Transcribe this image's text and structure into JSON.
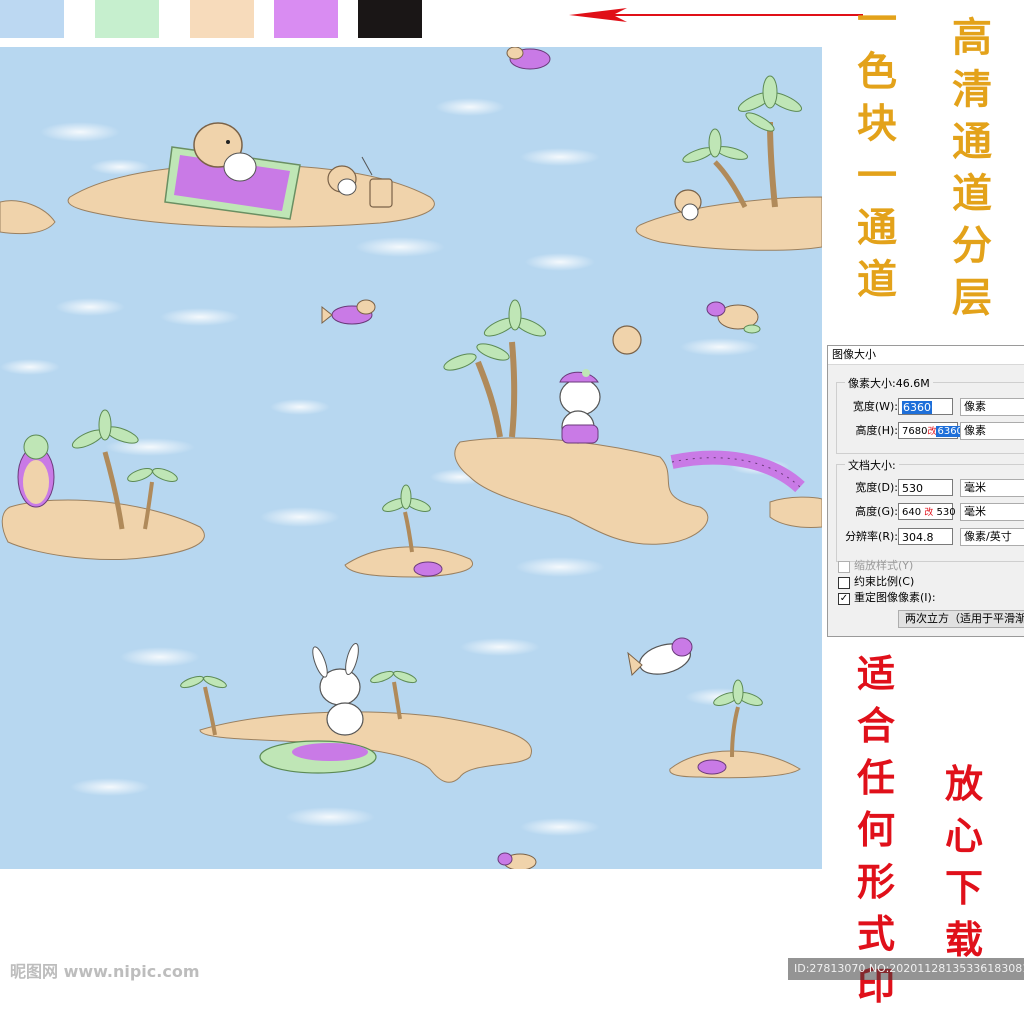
{
  "swatches": {
    "colors": [
      "#bcd8f2",
      "#c6efce",
      "#f7dbbb",
      "#d98cf2",
      "#1a1616"
    ]
  },
  "colors": {
    "sea": "#b7d7f0",
    "sand": "#f0d3ab",
    "leaf": "#bfe6b6",
    "purple": "#c97ae6",
    "arrow": "#e01018",
    "gold_text": "#e3a21a",
    "red_text": "#e0101a"
  },
  "pattern": {
    "icons": [
      "island-icon",
      "palm-tree-icon",
      "turtle-icon",
      "fish-icon",
      "hedgehog-icon",
      "rabbit-icon",
      "bridge-icon",
      "ball-icon"
    ]
  },
  "vertical_text": {
    "col1": [
      "一",
      "色",
      "块",
      "一",
      "通",
      "道"
    ],
    "col2": [
      "高",
      "清",
      "通",
      "道",
      "分",
      "层"
    ],
    "col3": [
      "适",
      "合",
      "任",
      "何",
      "形",
      "式",
      "印"
    ],
    "col4": [
      "放",
      "心",
      "下",
      "载"
    ]
  },
  "dialog": {
    "title": "图像大小",
    "pixel_group": "像素大小:46.6M",
    "width_label": "宽度(W):",
    "width_value": "6360",
    "width_unit": "像素",
    "height_label": "高度(H):",
    "height_value_old": "7680",
    "height_value_mark": "改",
    "height_value_new": "6360",
    "height_unit": "像素",
    "doc_group": "文档大小:",
    "doc_width_label": "宽度(D):",
    "doc_width_value": "530",
    "doc_width_unit": "毫米",
    "doc_height_label": "高度(G):",
    "doc_height_old": "640",
    "doc_height_mark": "改",
    "doc_height_new": "530",
    "doc_height_unit": "毫米",
    "res_label": "分辨率(R):",
    "res_value": "304.8",
    "res_unit": "像素/英寸",
    "scale_styles": "缩放样式(Y)",
    "constrain": "约束比例(C)",
    "resample": "重定图像像素(I):",
    "resample_method": "两次立方（适用于平滑渐变"
  },
  "watermark": "昵图网 www.nipic.com",
  "id_bar": "ID:27813070 NO:20201128135336183081"
}
